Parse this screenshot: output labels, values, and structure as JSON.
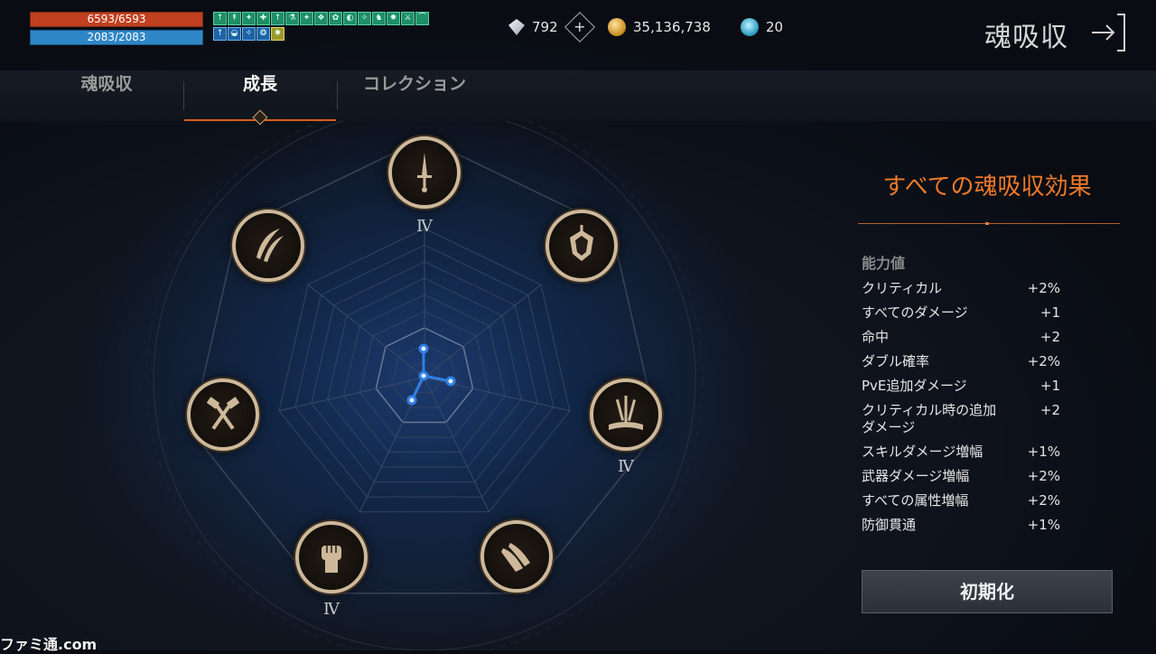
{
  "status": {
    "hp": "6593/6593",
    "mp": "2083/2083"
  },
  "buffs": {
    "row1": [
      "↑",
      "↟",
      "✦",
      "✚",
      "↑",
      "⚗",
      "✦",
      "❖",
      "✿",
      "◐",
      "✧",
      "♞",
      "✹",
      "⚔",
      "⌒"
    ],
    "row2": [
      "↑",
      "◒",
      "✧",
      "❂",
      "✹"
    ]
  },
  "currency": {
    "diamond": "792",
    "gold": "35,136,738",
    "soul": "20"
  },
  "page_title": "魂吸収",
  "tabs": [
    {
      "label": "魂吸収",
      "active": false
    },
    {
      "label": "成長",
      "active": true
    },
    {
      "label": "コレクション",
      "active": false
    }
  ],
  "radar": {
    "nodes": [
      {
        "icon": "dagger-icon",
        "tier": "Ⅳ"
      },
      {
        "icon": "shield-crest-icon",
        "tier": ""
      },
      {
        "icon": "swords-book-icon",
        "tier": "Ⅳ"
      },
      {
        "icon": "praying-hands-icon",
        "tier": ""
      },
      {
        "icon": "fist-icon",
        "tier": "Ⅳ"
      },
      {
        "icon": "crossed-hammers-icon",
        "tier": ""
      },
      {
        "icon": "feathers-icon",
        "tier": ""
      }
    ]
  },
  "effects": {
    "title": "すべての魂吸収効果",
    "section": "能力値",
    "stats": [
      {
        "name": "クリティカル",
        "value": "+2%"
      },
      {
        "name": "すべてのダメージ",
        "value": "+1"
      },
      {
        "name": "命中",
        "value": "+2"
      },
      {
        "name": "ダブル確率",
        "value": "+2%"
      },
      {
        "name": "PvE追加ダメージ",
        "value": "+1"
      },
      {
        "name": "クリティカル時の追加ダメージ",
        "value": "+2"
      },
      {
        "name": "スキルダメージ増幅",
        "value": "+1%"
      },
      {
        "name": "武器ダメージ増幅",
        "value": "+2%"
      },
      {
        "name": "すべての属性増幅",
        "value": "+2%"
      },
      {
        "name": "防御貫通",
        "value": "+1%"
      }
    ],
    "reset_label": "初期化"
  },
  "watermark": "ファミ通.com",
  "colors": {
    "accent": "#ee7a2a",
    "hp": "#c0401f",
    "mp": "#2f86c6",
    "radar_line": "#2f7fe6"
  }
}
